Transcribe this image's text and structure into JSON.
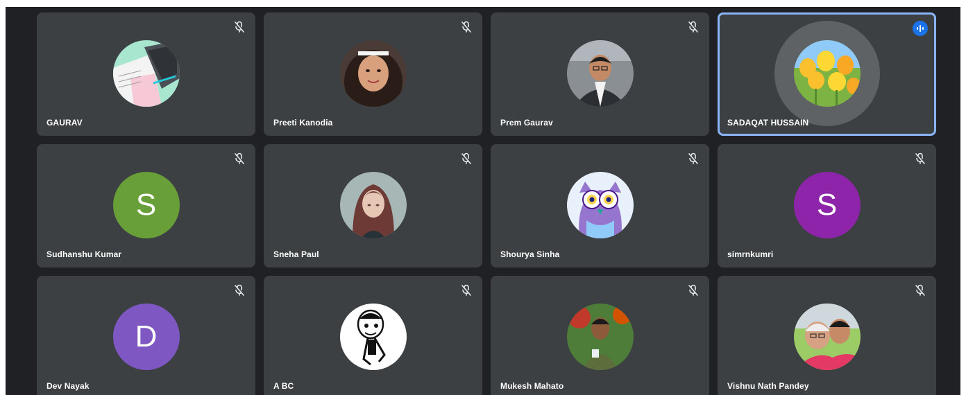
{
  "colors": {
    "background": "#202124",
    "tile": "#3c4043",
    "speaking_border": "#8ab4f8",
    "speaking_badge": "#1a73e8"
  },
  "participants": [
    {
      "name": "GAURAV",
      "avatar": "photo-laptop-desk",
      "muted": true,
      "speaking": false
    },
    {
      "name": "Preeti Kanodia",
      "avatar": "photo-woman-portrait",
      "muted": true,
      "speaking": false
    },
    {
      "name": "Prem Gaurav",
      "avatar": "photo-man-suit",
      "muted": true,
      "speaking": false
    },
    {
      "name": "SADAQAT HUSSAIN",
      "avatar": "photo-yellow-tulips",
      "muted": false,
      "speaking": true
    },
    {
      "name": "Sudhanshu Kumar",
      "avatar_letter": "S",
      "avatar_color": "#689f38",
      "muted": true,
      "speaking": false
    },
    {
      "name": "Sneha Paul",
      "avatar": "photo-anime-character",
      "muted": true,
      "speaking": false
    },
    {
      "name": "Shourya Sinha",
      "avatar": "photo-owl-drawing",
      "muted": true,
      "speaking": false
    },
    {
      "name": "simrnkumri",
      "avatar_letter": "S",
      "avatar_color": "#8e24aa",
      "muted": true,
      "speaking": false
    },
    {
      "name": "Dev Nayak",
      "avatar_letter": "D",
      "avatar_color": "#7e57c2",
      "muted": true,
      "speaking": false
    },
    {
      "name": "A BC",
      "avatar": "photo-cartoon-character",
      "muted": true,
      "speaking": false
    },
    {
      "name": "Mukesh Mahato",
      "avatar": "photo-man-outdoors",
      "muted": true,
      "speaking": false
    },
    {
      "name": "Vishnu Nath Pandey",
      "avatar": "photo-family-selfie",
      "muted": true,
      "speaking": false
    }
  ]
}
